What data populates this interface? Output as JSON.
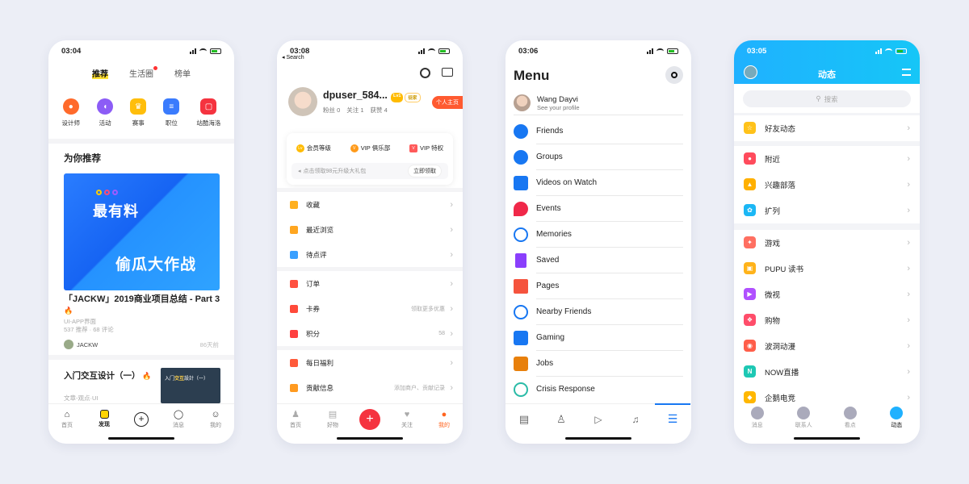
{
  "phone1": {
    "time": "03:04",
    "top_tabs": [
      "推荐",
      "生活圈",
      "榜单"
    ],
    "categories": [
      {
        "label": "设计师",
        "icon": "designer-icon",
        "color": "#ff6a2b"
      },
      {
        "label": "活动",
        "icon": "pacman-icon",
        "color": "#8c5cf6"
      },
      {
        "label": "赛事",
        "icon": "trophy-icon",
        "color": "#ffbe0b"
      },
      {
        "label": "职位",
        "icon": "document-icon",
        "color": "#3a7bfd"
      },
      {
        "label": "站酷海洛",
        "icon": "photo-icon",
        "color": "#f5333f"
      }
    ],
    "section_title": "为你推荐",
    "banner_title": "最有料",
    "banner_subtitle": "偷瓜大作战",
    "article_title": "「JACKW」2019商业项目总结 - Part 3",
    "article_category": "UI-APP界面",
    "article_stats": "537 推荐 · 68 评论",
    "author": "JACKW",
    "time_ago": "86天前",
    "article2_title": "入门交互设计（一）",
    "article2_meta": "文章-观点·UI",
    "thumb_text_a": "入门",
    "thumb_text_b": "交互",
    "thumb_text_c": "設計（一）",
    "tabs": [
      "首页",
      "发现",
      "",
      "消息",
      "我的"
    ]
  },
  "phone2": {
    "time": "03:08",
    "back_label": "◂ Search",
    "username": "dpuser_584...",
    "level_badge": "Lv1",
    "badge2": "徒家",
    "stats": [
      "粉丝 0",
      "关注 1",
      "获赞 4"
    ],
    "homepage_button": "个人主页",
    "vip_items": [
      "会员等级",
      "VIP 俱乐部",
      "VIP 特权"
    ],
    "gift_text": "点击领取98元升级大礼包",
    "gift_button": "立即领取",
    "rows_a": [
      {
        "label": "收藏",
        "color": "#ffb020"
      },
      {
        "label": "最近浏览",
        "color": "#ffa620"
      },
      {
        "label": "待点评",
        "color": "#3aa0ff"
      }
    ],
    "rows_b": [
      {
        "label": "订单",
        "value": "",
        "color": "#ff5040"
      },
      {
        "label": "卡券",
        "value": "领取更多优惠",
        "color": "#ff4a3a"
      },
      {
        "label": "积分",
        "value": "58",
        "color": "#ff4040"
      }
    ],
    "rows_c": [
      {
        "label": "每日福利",
        "value": "",
        "color": "#ff5a3a"
      },
      {
        "label": "贡献信息",
        "value": "添加商户、贡献记录",
        "color": "#ff9a20"
      }
    ],
    "tabs": [
      "首页",
      "好物",
      "+",
      "关注",
      "我的"
    ]
  },
  "phone3": {
    "time": "03:06",
    "title": "Menu",
    "profile_name": "Wang Dayvi",
    "profile_sub": "See your profile",
    "items": [
      {
        "label": "Friends",
        "color": "#1877f2"
      },
      {
        "label": "Groups",
        "color": "#1877f2"
      },
      {
        "label": "Videos on Watch",
        "color": "#1877f2"
      },
      {
        "label": "Events",
        "color": "#f02849"
      },
      {
        "label": "Memories",
        "color": "#1877f2"
      },
      {
        "label": "Saved",
        "color": "#8a3ffc"
      },
      {
        "label": "Pages",
        "color": "#f5533d"
      },
      {
        "label": "Nearby Friends",
        "color": "#1877f2"
      },
      {
        "label": "Gaming",
        "color": "#1877f2"
      },
      {
        "label": "Jobs",
        "color": "#e8800c"
      },
      {
        "label": "Crisis Response",
        "color": "#2abba7"
      }
    ]
  },
  "phone4": {
    "time": "03:05",
    "title": "动态",
    "search_placeholder": "搜索",
    "rows": [
      {
        "label": "好友动态",
        "color": "#ffc21a",
        "glyph": "☆"
      },
      {
        "label": "附近",
        "color": "#ff4b5c",
        "glyph": "●"
      },
      {
        "label": "兴趣部落",
        "color": "#ffb000",
        "glyph": "▲"
      },
      {
        "label": "扩列",
        "color": "#1bb7f5",
        "glyph": "✿"
      },
      {
        "label": "游戏",
        "color": "#ff6f61",
        "glyph": "✦"
      },
      {
        "label": "PUPU 读书",
        "color": "#ffb31a",
        "glyph": "▣"
      },
      {
        "label": "微视",
        "color": "#b050ff",
        "glyph": "▶"
      },
      {
        "label": "购物",
        "color": "#ff4d6a",
        "glyph": "❖"
      },
      {
        "label": "波洞动漫",
        "color": "#ff5e4a",
        "glyph": "◉"
      },
      {
        "label": "NOW直播",
        "color": "#1ec8b4",
        "glyph": "N"
      },
      {
        "label": "企鹅电竞",
        "color": "#ffb700",
        "glyph": "◆"
      }
    ],
    "tabs": [
      "消息",
      "联系人",
      "看点",
      "动态"
    ]
  }
}
